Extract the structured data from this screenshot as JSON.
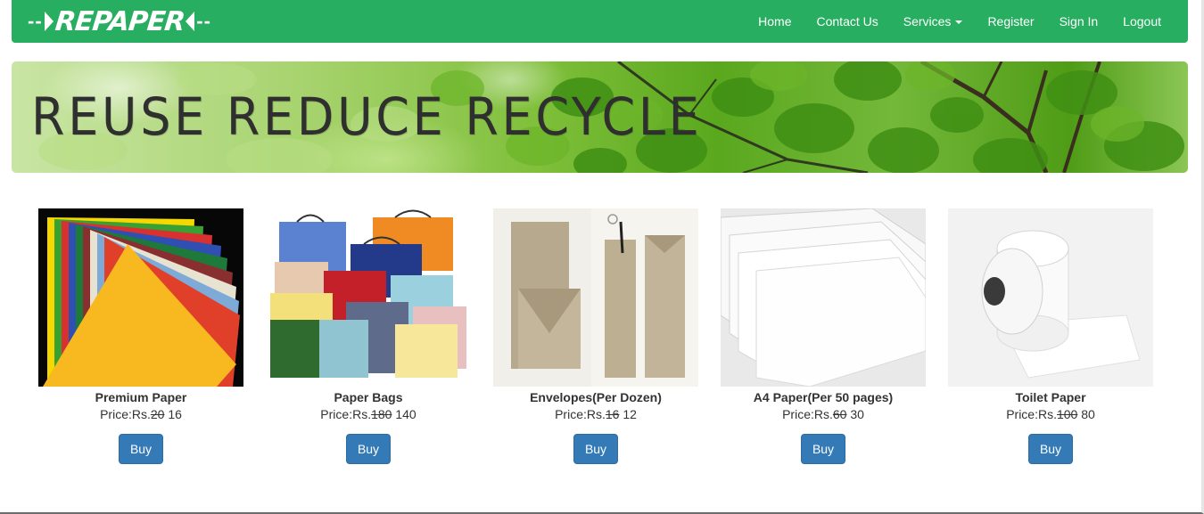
{
  "navbar": {
    "brand": "REPAPER",
    "brand_left_dashes": "--",
    "brand_right_dashes": "--",
    "color": "#27ae60",
    "items": [
      {
        "label": "Home"
      },
      {
        "label": "Contact Us"
      },
      {
        "label": "Services"
      },
      {
        "label": "Register"
      },
      {
        "label": "Sign In"
      },
      {
        "label": "Logout"
      }
    ]
  },
  "banner": {
    "text": "REUSE REDUCE RECYCLE"
  },
  "products": [
    {
      "name": "Premium Paper",
      "price_prefix": "Price:Rs.",
      "old_price": "20",
      "new_price": " 16",
      "button": "Buy"
    },
    {
      "name": "Paper Bags",
      "price_prefix": "Price:Rs.",
      "old_price": "180",
      "new_price": " 140",
      "button": "Buy"
    },
    {
      "name": "Envelopes(Per Dozen)",
      "price_prefix": "Price:Rs.",
      "old_price": "16",
      "new_price": " 12",
      "button": "Buy"
    },
    {
      "name": "A4 Paper(Per 50 pages)",
      "price_prefix": "Price:Rs.",
      "old_price": "60",
      "new_price": " 30",
      "button": "Buy"
    },
    {
      "name": "Toilet Paper",
      "price_prefix": "Price:Rs.",
      "old_price": "100",
      "new_price": " 80",
      "button": "Buy"
    }
  ],
  "colors": {
    "button": "#337ab7"
  }
}
